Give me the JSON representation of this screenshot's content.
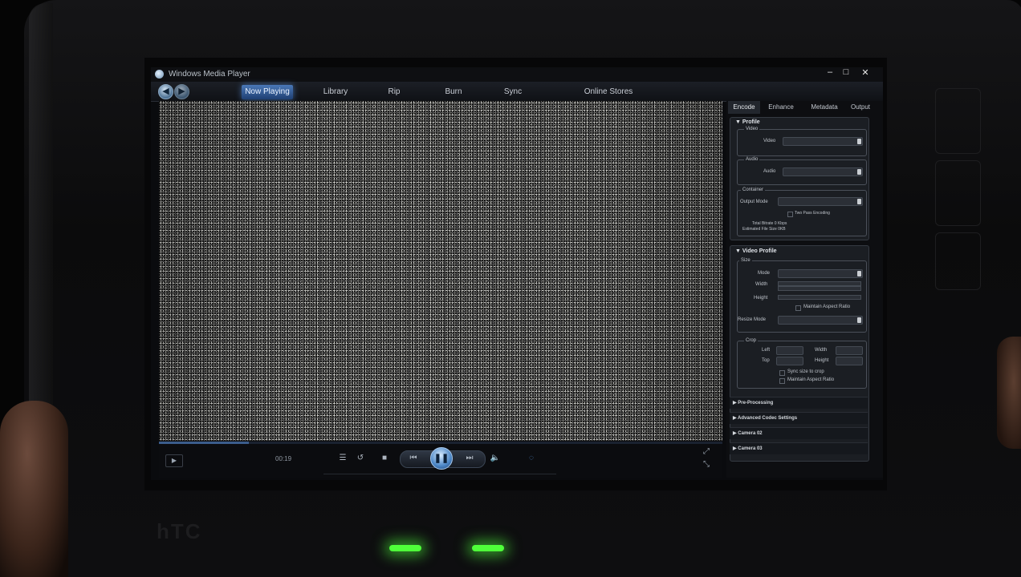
{
  "window": {
    "title": "Windows Media Player",
    "minimize": "‒",
    "maximize": "□",
    "close": "✕"
  },
  "nav": {
    "back": "◀",
    "forward": "▶",
    "tabs": [
      "Now Playing",
      "Library",
      "Rip",
      "Burn",
      "Sync",
      "Online Stores"
    ],
    "active": "Now Playing"
  },
  "transport": {
    "time": "00:19",
    "progress": 0.16,
    "play_mode": "▶",
    "playlist_icon": "☰",
    "repeat_icon": "↺",
    "stop_icon": "■",
    "prev_icon": "⏮",
    "pause_icon": "❚❚",
    "next_icon": "⏭",
    "volume_icon": "🔈",
    "volume_marker": "◌",
    "fullscreen_icon": "⤢",
    "compact_icon": "⤡"
  },
  "panel": {
    "tabs": [
      "Encode",
      "Enhance",
      "Metadata",
      "Output"
    ],
    "profile": {
      "title": "▼ Profile",
      "video_group": "Video",
      "video_label": "Video",
      "audio_group": "Audio",
      "audio_label": "Audio",
      "container_group": "Container",
      "output_mode_label": "Output Mode",
      "two_pass": "Two Pass Encoding",
      "total_bitrate": "Total Bitrate 0 Kbps",
      "estimated_size": "Estimated File Size 0KB"
    },
    "video_profile": {
      "title": "▼ Video Profile",
      "size_group": "Size",
      "mode_label": "Mode",
      "width_label": "Width",
      "height_label": "Height",
      "maintain_aspect": "Maintain Aspect Ratio",
      "resize_mode_label": "Resize Mode",
      "crop_group": "Crop",
      "left_label": "Left",
      "width2_label": "Width",
      "top_label": "Top",
      "height2_label": "Height",
      "sync_size": "Sync size to crop",
      "maintain_aspect2": "Maintain Aspect Ratio"
    },
    "collapsed": [
      "▶  Pre-Processing",
      "▶  Advanced Codec Settings",
      "▶  Camera 02",
      "▶  Camera 03"
    ]
  },
  "device": {
    "brand": "hTC"
  }
}
